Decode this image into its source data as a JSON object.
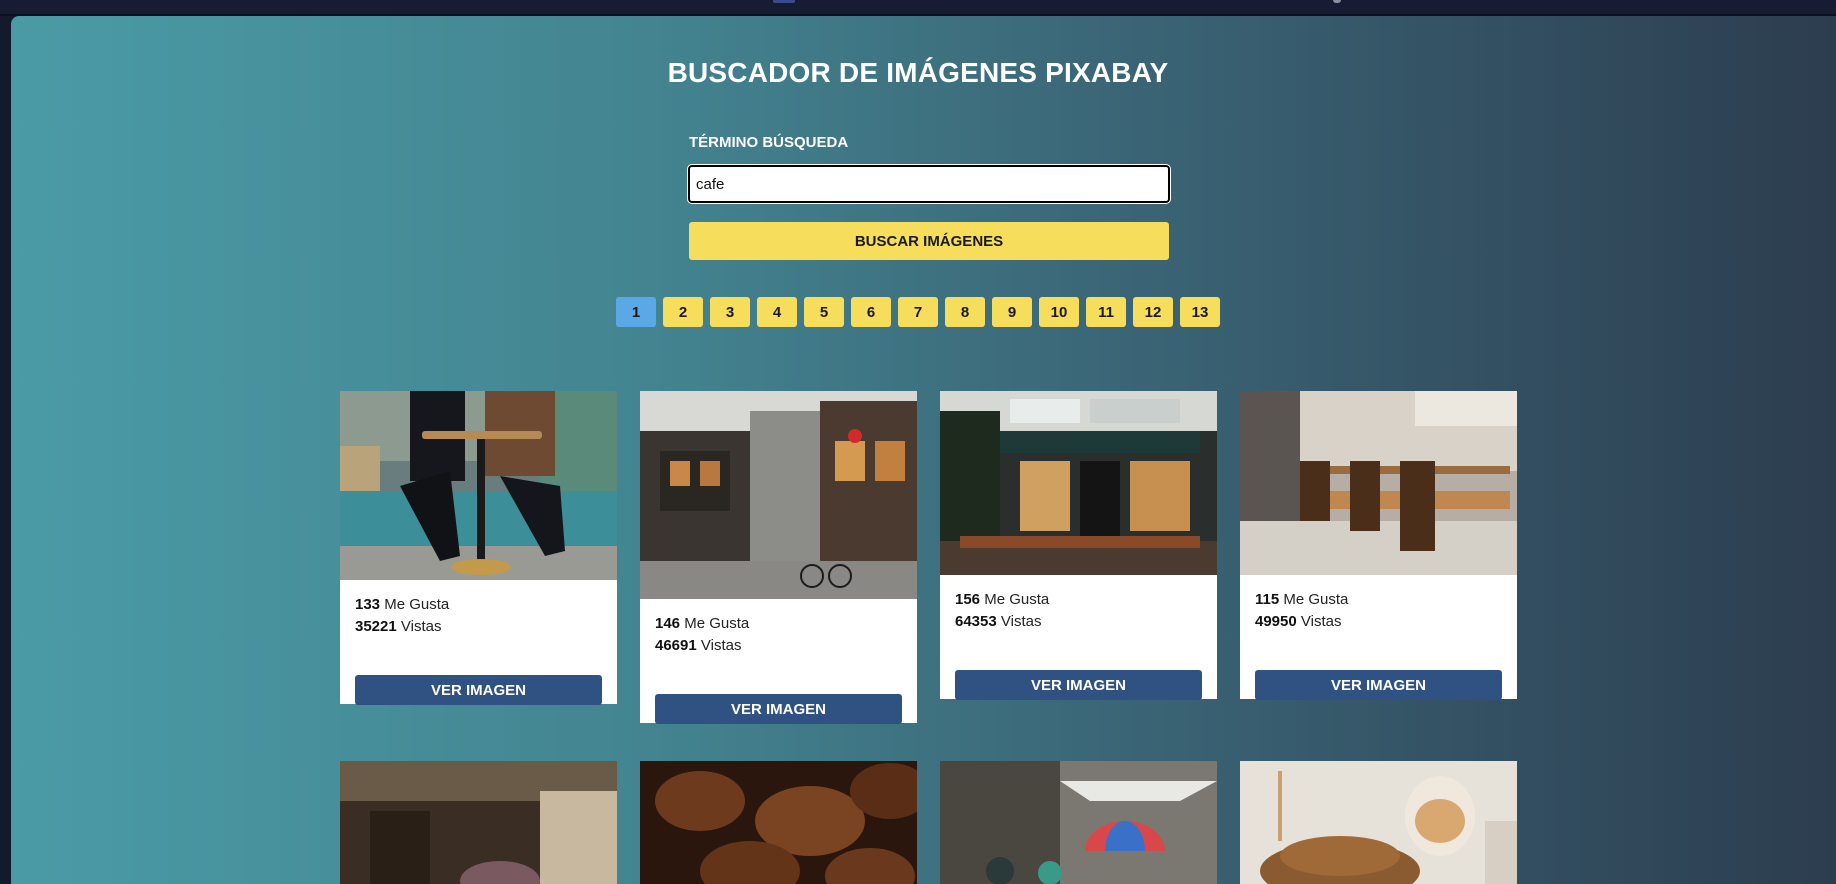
{
  "title": "BUSCADOR DE IMÁGENES PIXABAY",
  "search": {
    "label": "TÉRMINO BÚSQUEDA",
    "value": "cafe",
    "button_label": "BUSCAR IMÁGENES"
  },
  "pagination": {
    "current": "1",
    "pages": [
      "1",
      "2",
      "3",
      "4",
      "5",
      "6",
      "7",
      "8",
      "9",
      "10",
      "11",
      "12",
      "13"
    ]
  },
  "cards": [
    {
      "likes": "133",
      "likes_label": "Me Gusta",
      "views": "35221",
      "views_label": "Vistas",
      "button": "VER IMAGEN",
      "image": "people-at-cafe-table-photo"
    },
    {
      "likes": "146",
      "likes_label": "Me Gusta",
      "views": "46691",
      "views_label": "Vistas",
      "button": "VER IMAGEN",
      "image": "street-corner-cafe-photo"
    },
    {
      "likes": "156",
      "likes_label": "Me Gusta",
      "views": "64353",
      "views_label": "Vistas",
      "button": "VER IMAGEN",
      "image": "cafe-storefront-photo"
    },
    {
      "likes": "115",
      "likes_label": "Me Gusta",
      "views": "49950",
      "views_label": "Vistas",
      "button": "VER IMAGEN",
      "image": "empty-cafe-interior-photo"
    }
  ],
  "second_row_images": [
    "cafe-interior-photo",
    "coffee-beans-photo",
    "street-umbrellas-photo",
    "pancakes-and-coffee-photo"
  ],
  "colors": {
    "accent_yellow": "#f6dd5c",
    "active_page": "#5aa9e6",
    "view_button": "#2f5283"
  }
}
